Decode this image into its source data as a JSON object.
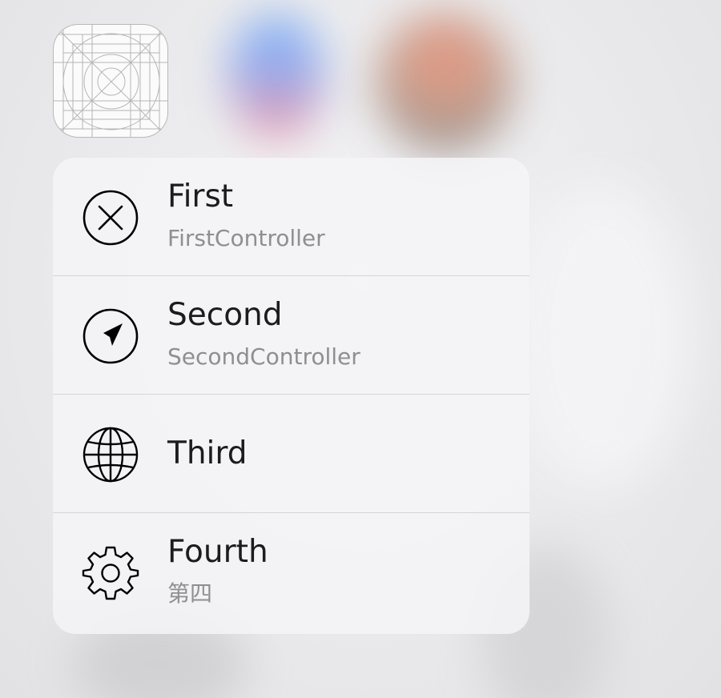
{
  "app_icon": {
    "icon": "app-icon-template-grid-icon"
  },
  "menu": {
    "items": [
      {
        "title": "First",
        "subtitle": "FirstController",
        "icon": "close-circle-icon"
      },
      {
        "title": "Second",
        "subtitle": "SecondController",
        "icon": "location-arrow-icon"
      },
      {
        "title": "Third",
        "subtitle": "",
        "icon": "globe-icon"
      },
      {
        "title": "Fourth",
        "subtitle": "第四",
        "icon": "gear-icon"
      }
    ]
  },
  "colors": {
    "title_text": "#1c1c1e",
    "subtitle_text": "#8e8e93",
    "icon_stroke": "#000000",
    "menu_background": "#f5f5f7",
    "separator": "#d5d5d8"
  }
}
